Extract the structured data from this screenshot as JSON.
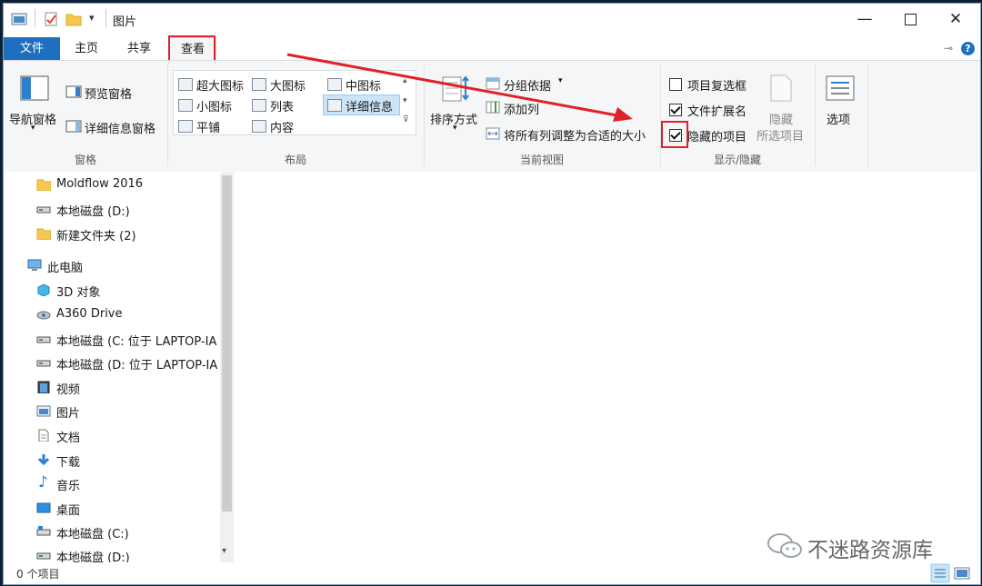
{
  "window": {
    "title": "图片"
  },
  "tabs": {
    "file": "文件",
    "home": "主页",
    "share": "共享",
    "view": "查看"
  },
  "help_glyph": "?",
  "ribbon": {
    "panes": {
      "nav_pane_line1": "导航窗格",
      "preview": "预览窗格",
      "details": "详细信息窗格",
      "label": "窗格"
    },
    "layout": {
      "items": [
        "超大图标",
        "大图标",
        "中图标",
        "小图标",
        "列表",
        "详细信息",
        "平铺",
        "内容"
      ],
      "selected": "详细信息",
      "label": "布局"
    },
    "current_view": {
      "sort_line1": "排序方式",
      "group_by": "分组依据",
      "add_columns": "添加列",
      "size_all": "将所有列调整为合适的大小",
      "label": "当前视图"
    },
    "show_hide": {
      "item_checkboxes": {
        "label": "项目复选框",
        "checked": false
      },
      "file_ext": {
        "label": "文件扩展名",
        "checked": true
      },
      "hidden_items": {
        "label": "隐藏的项目",
        "checked": true
      },
      "hide_line1": "隐藏",
      "hide_line2": "所选项目",
      "label": "显示/隐藏"
    },
    "options": "选项"
  },
  "nav": {
    "items": [
      {
        "label": "Moldflow 2016",
        "icon": "folder-icon"
      },
      {
        "label": "本地磁盘 (D:)",
        "icon": "drive-icon"
      },
      {
        "label": "新建文件夹 (2)",
        "icon": "folder-icon"
      },
      {
        "label": "此电脑",
        "icon": "pc-icon"
      },
      {
        "label": "3D 对象",
        "icon": "3d-objects-icon"
      },
      {
        "label": "A360 Drive",
        "icon": "a360-drive-icon"
      },
      {
        "label": "本地磁盘 (C: 位于 LAPTOP-IA",
        "icon": "drive-icon"
      },
      {
        "label": "本地磁盘 (D: 位于 LAPTOP-IA",
        "icon": "drive-icon"
      },
      {
        "label": "视频",
        "icon": "video-icon"
      },
      {
        "label": "图片",
        "icon": "pictures-icon"
      },
      {
        "label": "文档",
        "icon": "documents-icon"
      },
      {
        "label": "下载",
        "icon": "download-icon"
      },
      {
        "label": "音乐",
        "icon": "music-icon"
      },
      {
        "label": "桌面",
        "icon": "desktop-icon"
      },
      {
        "label": "本地磁盘 (C:)",
        "icon": "drive-icon"
      },
      {
        "label": "本地磁盘 (D:)",
        "icon": "drive-icon"
      }
    ]
  },
  "status": {
    "count": "0 个项目"
  },
  "watermark": "不迷路资源库",
  "colors": {
    "accent": "#1e6fc0",
    "highlight": "#e0202a"
  }
}
